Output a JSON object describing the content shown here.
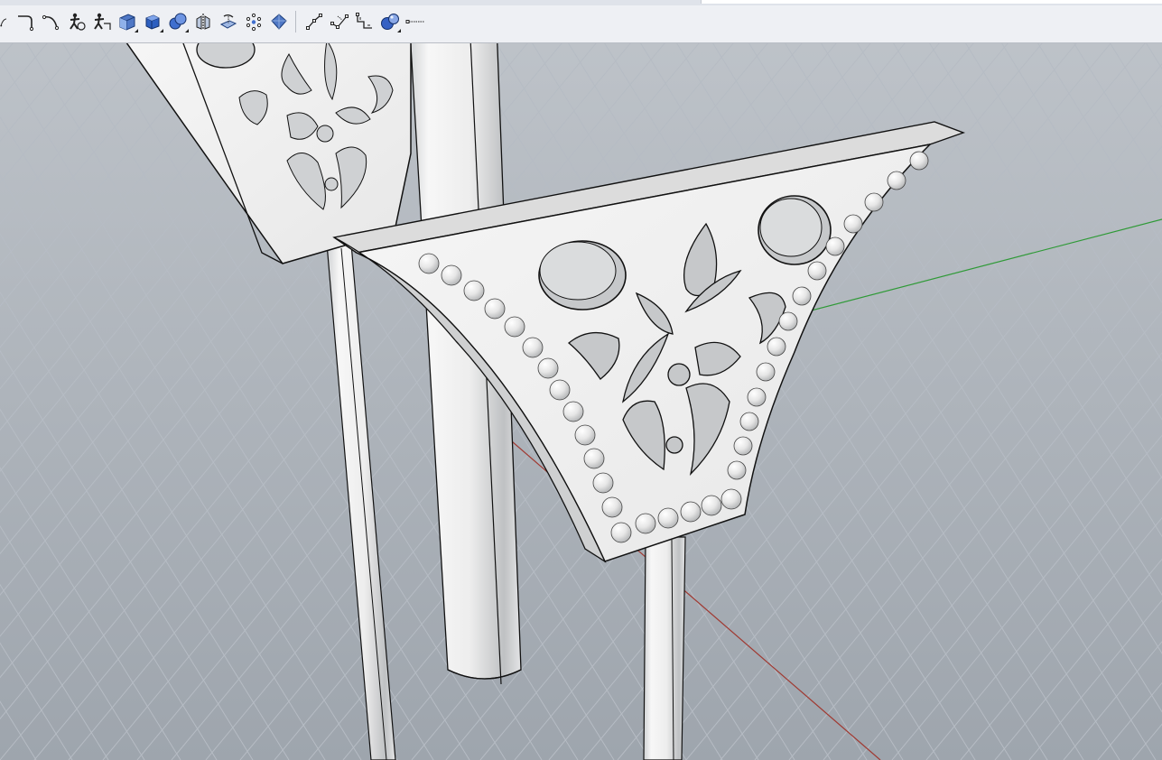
{
  "toolbar": {
    "tools": [
      {
        "icon": "partial-arc-icon",
        "flyout": false
      },
      {
        "icon": "curve-fillet-icon",
        "flyout": false
      },
      {
        "icon": "arc-icon",
        "flyout": false
      },
      {
        "icon": "sweep-one-rail-icon",
        "flyout": false
      },
      {
        "icon": "sweep-two-rail-icon",
        "flyout": false
      },
      {
        "icon": "solid-box-icon",
        "flyout": true
      },
      {
        "icon": "solid-box-blue-icon",
        "flyout": true
      },
      {
        "icon": "boolean-union-icon",
        "flyout": true
      },
      {
        "icon": "mirror-icon",
        "flyout": false
      },
      {
        "icon": "project-curve-icon",
        "flyout": false
      },
      {
        "icon": "array-icon",
        "flyout": false
      },
      {
        "icon": "surface-from-points-icon",
        "flyout": false
      },
      {
        "icon": "polyline-icon",
        "flyout": false
      },
      {
        "icon": "edit-points-icon",
        "flyout": false
      },
      {
        "icon": "dimension-icon",
        "flyout": false
      },
      {
        "icon": "render-sphere-icon",
        "flyout": true
      },
      {
        "icon": "line-end-icon",
        "flyout": false
      }
    ]
  },
  "viewport": {
    "view": "Perspective",
    "grid": true,
    "background_color": "#a9b0b8",
    "grid_line_color": "#b6bcc4",
    "x_axis_color": "#a03a32",
    "y_axis_color": "#2f9a37",
    "model_color": "#f2f2f2",
    "edge_color": "#111111"
  }
}
